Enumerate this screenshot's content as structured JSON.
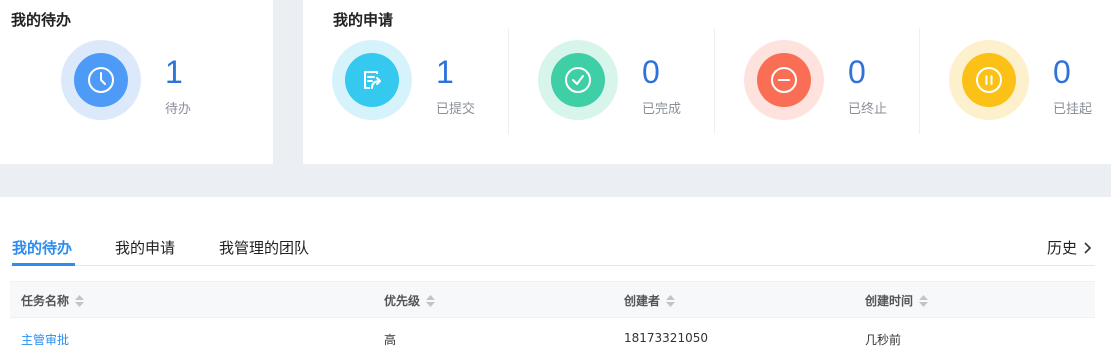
{
  "todo_panel": {
    "title": "我的待办",
    "stat": {
      "count": "1",
      "label": "待办",
      "icon": "clock-icon",
      "ring": "#dbe9fb",
      "disc": "#4e9bf7"
    }
  },
  "apply_panel": {
    "title": "我的申请",
    "stats": [
      {
        "count": "1",
        "label": "已提交",
        "icon": "submit-icon",
        "ring": "#d6f3fb",
        "disc": "#35c9ef"
      },
      {
        "count": "0",
        "label": "已完成",
        "icon": "check-icon",
        "ring": "#d8f5ec",
        "disc": "#3ecfa6"
      },
      {
        "count": "0",
        "label": "已终止",
        "icon": "minus-icon",
        "ring": "#fde2de",
        "disc": "#fa6e56"
      },
      {
        "count": "0",
        "label": "已挂起",
        "icon": "pause-icon",
        "ring": "#fdf0cc",
        "disc": "#fbc116"
      }
    ]
  },
  "colors": {
    "accent": "#2d8cf0",
    "count": "#2d73d9"
  },
  "tabs": [
    "我的待办",
    "我的申请",
    "我管理的团队"
  ],
  "history_label": "历史",
  "table": {
    "headers": [
      "任务名称",
      "优先级",
      "创建者",
      "创建时间"
    ],
    "rows": [
      {
        "name": "主管审批",
        "priority": "高",
        "creator": "18173321050",
        "time": "几秒前"
      }
    ]
  }
}
